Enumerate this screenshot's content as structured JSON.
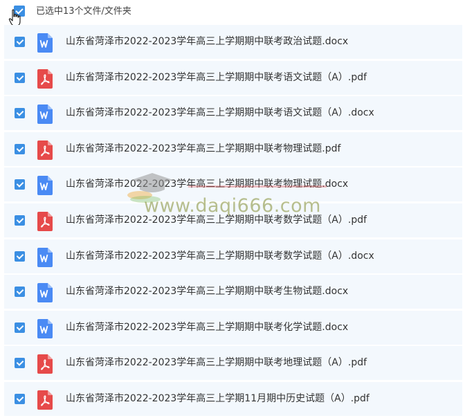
{
  "header": {
    "label": "已选中13个文件/文件夹"
  },
  "files": [
    {
      "name": "山东省菏泽市2022-2023学年高三上学期期中联考政治试题.docx",
      "type": "docx",
      "icon": "word-icon"
    },
    {
      "name": "山东省菏泽市2022-2023学年高三上学期期中联考语文试题（A）.pdf",
      "type": "pdf",
      "icon": "pdf-icon"
    },
    {
      "name": "山东省菏泽市2022-2023学年高三上学期期中联考语文试题（A）.docx",
      "type": "docx",
      "icon": "word-icon"
    },
    {
      "name": "山东省菏泽市2022-2023学年高三上学期期中联考物理试题.pdf",
      "type": "pdf",
      "icon": "pdf-icon"
    },
    {
      "name": "山东省菏泽市2022-2023学年高三上学期期中联考物理试题.docx",
      "type": "docx",
      "icon": "word-icon"
    },
    {
      "name": "山东省菏泽市2022-2023学年高三上学期期中联考数学试题（A）.pdf",
      "type": "pdf",
      "icon": "pdf-icon"
    },
    {
      "name": "山东省菏泽市2022-2023学年高三上学期期中联考数学试题（A）.docx",
      "type": "docx",
      "icon": "word-icon"
    },
    {
      "name": "山东省菏泽市2022-2023学年高三上学期期中联考生物试题.docx",
      "type": "docx",
      "icon": "word-icon"
    },
    {
      "name": "山东省菏泽市2022-2023学年高三上学期期中联考化学试题.docx",
      "type": "docx",
      "icon": "word-icon"
    },
    {
      "name": "山东省菏泽市2022-2023学年高三上学期期中联考地理试题（A）.pdf",
      "type": "pdf",
      "icon": "pdf-icon"
    },
    {
      "name": "山东省菏泽市2022-2023学年高三上学期11月期中历史试题（A）.pdf",
      "type": "pdf",
      "icon": "pdf-icon"
    }
  ],
  "watermark": {
    "text": "www.daqi666.com"
  },
  "colors": {
    "checkbox": "#3b8fe3",
    "word": "#4a8af4",
    "pdf": "#e64a4a",
    "row_bg": "#f3f8fd"
  }
}
